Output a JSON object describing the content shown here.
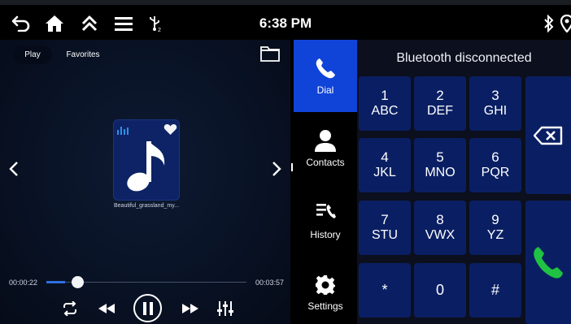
{
  "status_bar": {
    "time": "6:38 PM",
    "icons": [
      "back-arrow-icon",
      "home-icon",
      "double-chevron-up-icon",
      "menu-icon",
      "usb-icon",
      "bluetooth-icon",
      "location-pin-icon"
    ]
  },
  "media": {
    "tabs": [
      {
        "label": "Play",
        "active": true
      },
      {
        "label": "Favorites",
        "active": false
      }
    ],
    "track_title": "Beautiful_grassland_my...",
    "elapsed": "00:00:22",
    "duration": "00:03:57",
    "progress_fraction": 0.093,
    "favorited": true,
    "controls": [
      "repeat-icon",
      "rewind-icon",
      "pause-icon",
      "fast-forward-icon",
      "equalizer-icon"
    ]
  },
  "phone": {
    "status": "Bluetooth disconnected",
    "nav": [
      {
        "label": "Dial",
        "icon": "phone-icon",
        "active": true
      },
      {
        "label": "Contacts",
        "icon": "person-icon",
        "active": false
      },
      {
        "label": "History",
        "icon": "call-history-icon",
        "active": false
      },
      {
        "label": "Settings",
        "icon": "gear-icon",
        "active": false
      }
    ],
    "keys": [
      {
        "num": "1",
        "letters": "ABC"
      },
      {
        "num": "2",
        "letters": "DEF"
      },
      {
        "num": "3",
        "letters": "GHI"
      },
      {
        "num": "4",
        "letters": "JKL"
      },
      {
        "num": "5",
        "letters": "MNO"
      },
      {
        "num": "6",
        "letters": "PQR"
      },
      {
        "num": "7",
        "letters": "STU"
      },
      {
        "num": "8",
        "letters": "VWX"
      },
      {
        "num": "9",
        "letters": "YZ"
      },
      {
        "num": "*",
        "letters": ""
      },
      {
        "num": "0",
        "letters": ""
      },
      {
        "num": "#",
        "letters": ""
      }
    ],
    "call_color": "#1fc243"
  }
}
